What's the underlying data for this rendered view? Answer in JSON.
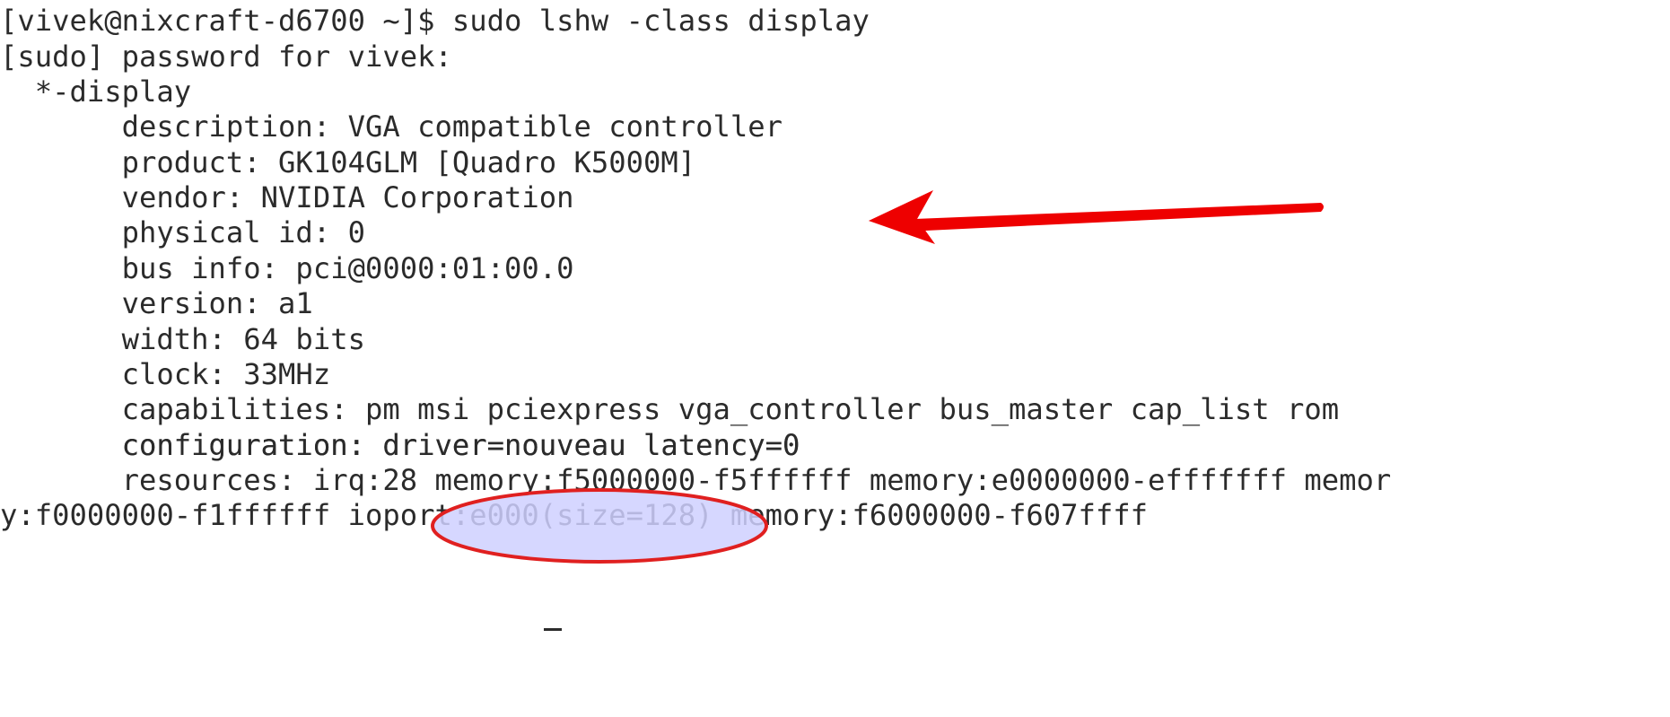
{
  "terminal": {
    "lines": [
      "[vivek@nixcraft-d6700 ~]$ sudo lshw -class display",
      "[sudo] password for vivek:",
      "  *-display",
      "       description: VGA compatible controller",
      "       product: GK104GLM [Quadro K5000M]",
      "       vendor: NVIDIA Corporation",
      "       physical id: 0",
      "       bus info: pci@0000:01:00.0",
      "       version: a1",
      "       width: 64 bits",
      "       clock: 33MHz",
      "       capabilities: pm msi pciexpress vga_controller bus_master cap_list rom",
      "       configuration: driver=nouveau latency=0",
      "       resources: irq:28 memory:f5000000-f5ffffff memory:e0000000-efffffff memor",
      "y:f0000000-f1ffffff ioport:e000(size=128) memory:f6000000-f607ffff"
    ]
  },
  "annotations": {
    "arrow_color": "#ee0000",
    "ellipse_stroke": "#e02020",
    "ellipse_fill": "#cfd0ff"
  }
}
